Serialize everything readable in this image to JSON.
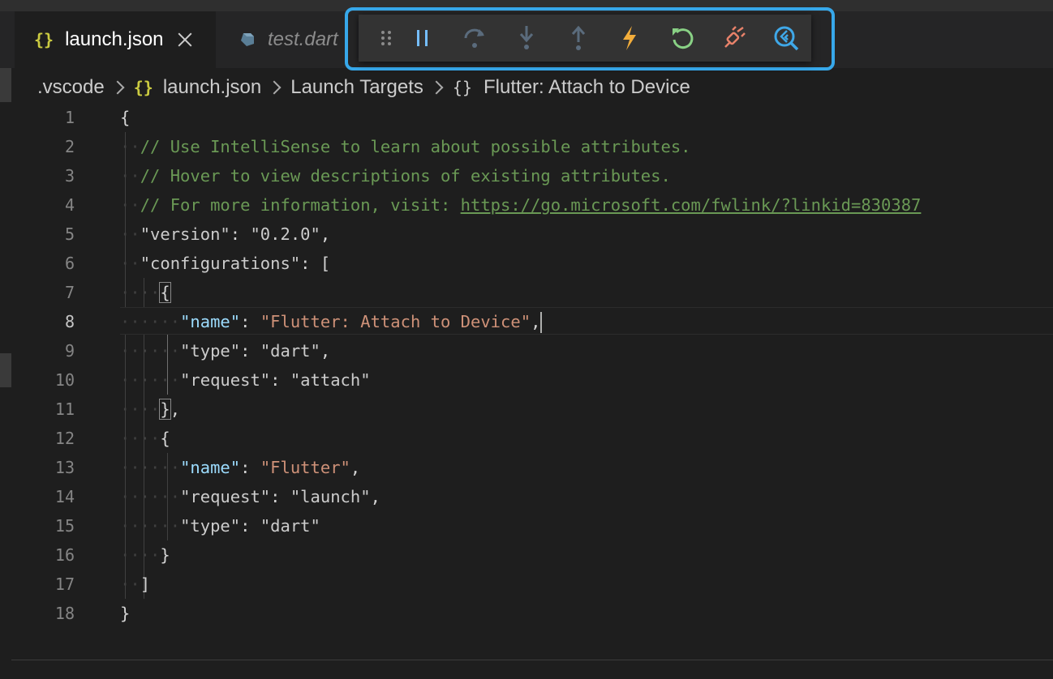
{
  "tabs": [
    {
      "label": "launch.json",
      "icon": "braces-icon",
      "active": true
    },
    {
      "label": "test.dart",
      "icon": "dart-icon",
      "active": false
    }
  ],
  "debug_toolbar": [
    {
      "name": "drag-handle",
      "color": "#8b8b8b"
    },
    {
      "name": "pause",
      "color": "#75beff"
    },
    {
      "name": "step-over",
      "color": "#5a6b7c"
    },
    {
      "name": "step-into",
      "color": "#5a6b7c"
    },
    {
      "name": "step-out",
      "color": "#5a6b7c"
    },
    {
      "name": "hot-reload",
      "color": "#f2ad3b"
    },
    {
      "name": "restart",
      "color": "#89d185"
    },
    {
      "name": "disconnect",
      "color": "#e8826a"
    },
    {
      "name": "flutter-inspector",
      "color": "#3fa8e8"
    }
  ],
  "breadcrumb": {
    "folder": ".vscode",
    "file": "launch.json",
    "section": "Launch Targets",
    "item": "Flutter: Attach to Device"
  },
  "code": {
    "comment1": "// Use IntelliSense to learn about possible attributes.",
    "comment2": "// Hover to view descriptions of existing attributes.",
    "comment3_prefix": "// For more information, visit: ",
    "comment3_link": "https://go.microsoft.com/fwlink/?linkid=830387",
    "version_key": "\"version\"",
    "version_val": "\"0.2.0\"",
    "configurations_key": "\"configurations\"",
    "config1": {
      "name_key": "\"name\"",
      "name_val": "\"Flutter: Attach to Device\"",
      "type_key": "\"type\"",
      "type_val": "\"dart\"",
      "request_key": "\"request\"",
      "request_val": "\"attach\""
    },
    "config2": {
      "name_key": "\"name\"",
      "name_val": "\"Flutter\"",
      "request_key": "\"request\"",
      "request_val": "\"launch\"",
      "type_key": "\"type\"",
      "type_val": "\"dart\""
    }
  },
  "line_numbers": [
    "1",
    "2",
    "3",
    "4",
    "5",
    "6",
    "7",
    "8",
    "9",
    "10",
    "11",
    "12",
    "13",
    "14",
    "15",
    "16",
    "17",
    "18"
  ]
}
